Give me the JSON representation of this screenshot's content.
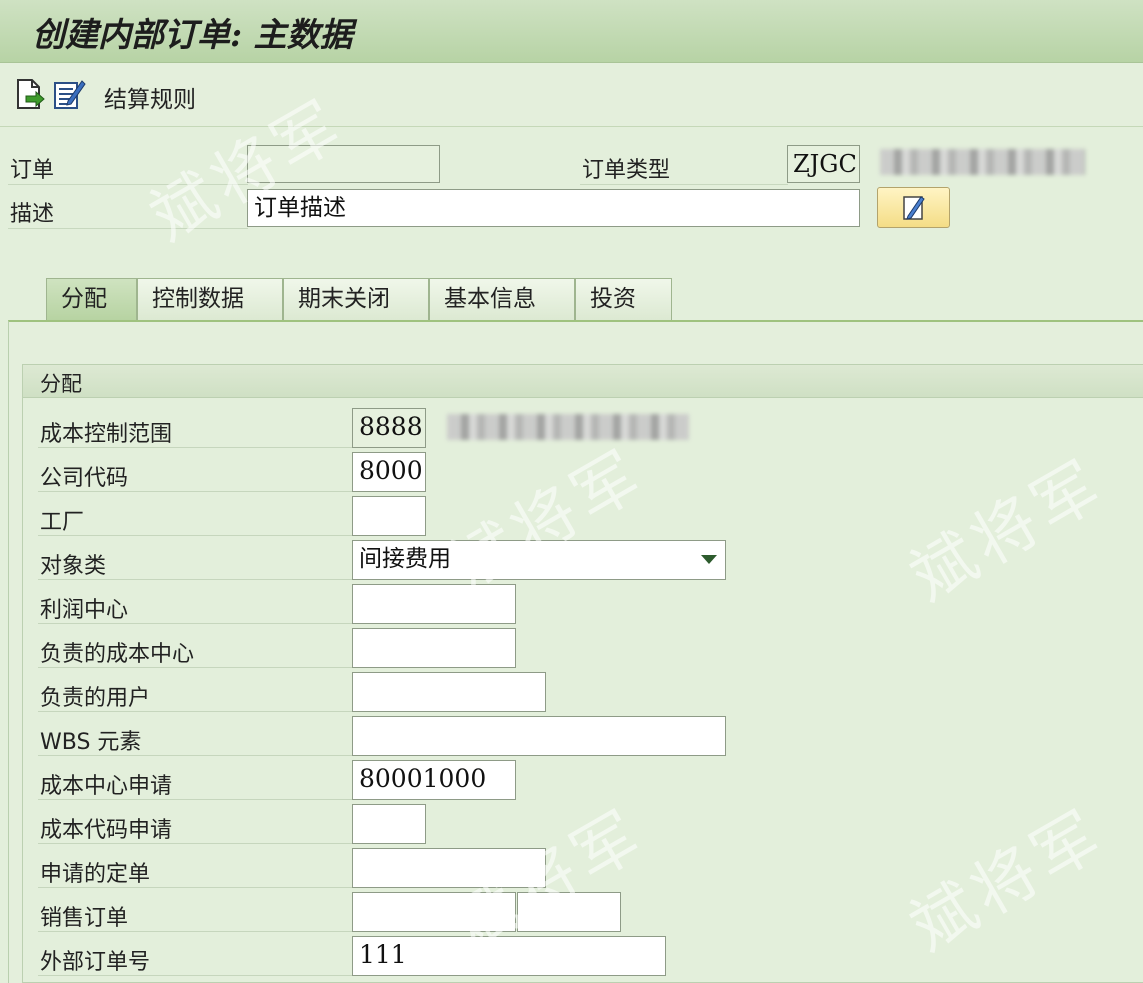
{
  "window": {
    "title": "创建内部订单: 主数据"
  },
  "toolbar": {
    "icons": [
      "create-document-icon",
      "edit-list-icon"
    ],
    "settlement_rule_label": "结算规则"
  },
  "header": {
    "order_label": "订单",
    "order_value": "",
    "order_type_label": "订单类型",
    "order_type_value": "ZJGC",
    "description_label": "描述",
    "description_value": "订单描述"
  },
  "tabs": [
    {
      "label": "分配",
      "active": true
    },
    {
      "label": "控制数据",
      "active": false
    },
    {
      "label": "期末关闭",
      "active": false
    },
    {
      "label": "基本信息",
      "active": false
    },
    {
      "label": "投资",
      "active": false
    }
  ],
  "assignment": {
    "group_title": "分配",
    "controlling_area_label": "成本控制范围",
    "controlling_area_value": "8888",
    "company_code_label": "公司代码",
    "company_code_value": "8000",
    "plant_label": "工厂",
    "plant_value": "",
    "object_class_label": "对象类",
    "object_class_value": "间接费用",
    "profit_center_label": "利润中心",
    "profit_center_value": "",
    "responsible_cost_center_label": "负责的成本中心",
    "responsible_cost_center_value": "",
    "responsible_user_label": "负责的用户",
    "responsible_user_value": "",
    "wbs_element_label": "WBS 元素",
    "wbs_element_value": "",
    "requesting_cost_center_label": "成本中心申请",
    "requesting_cost_center_value": "80001000",
    "requesting_company_code_label": "成本代码申请",
    "requesting_company_code_value": "",
    "requesting_order_label": "申请的定单",
    "requesting_order_value": "",
    "sales_order_label": "销售订单",
    "sales_order_value": "",
    "sales_order_item_value": "",
    "external_order_no_label": "外部订单号",
    "external_order_no_value": "111"
  },
  "watermark": {
    "text": "斌将军"
  },
  "colors": {
    "title_bar": "#b7d3a5",
    "background": "#e3efdb",
    "active_tab": "#b7d3a2",
    "edit_button": "#f4dd86"
  }
}
